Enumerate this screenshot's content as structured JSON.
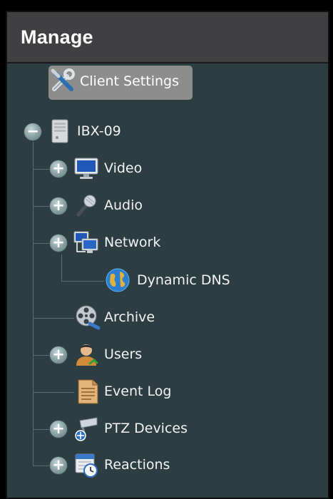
{
  "header": {
    "title": "Manage"
  },
  "tree": {
    "client_settings": {
      "label": "Client Settings",
      "icon": "tools-icon"
    },
    "root": {
      "label": "IBX-09",
      "icon": "server-icon",
      "expander": "−"
    },
    "items": [
      {
        "label": "Video",
        "icon": "monitor-icon",
        "expander": "+"
      },
      {
        "label": "Audio",
        "icon": "microphone-icon",
        "expander": "+"
      },
      {
        "label": "Network",
        "icon": "network-icon",
        "expander": "+"
      },
      {
        "label": "Dynamic DNS",
        "icon": "globe-icon"
      },
      {
        "label": "Archive",
        "icon": "film-reel-icon"
      },
      {
        "label": "Users",
        "icon": "user-icon",
        "expander": "+"
      },
      {
        "label": "Event Log",
        "icon": "document-icon"
      },
      {
        "label": "PTZ Devices",
        "icon": "camera-icon",
        "expander": "+"
      },
      {
        "label": "Reactions",
        "icon": "calendar-clock-icon",
        "expander": "+"
      }
    ]
  },
  "colors": {
    "panel_bg": "#2c3e41",
    "header_bg": "#404042",
    "selection_bg": "#8d8d8d",
    "tree_line": "#566f70",
    "text": "#f2f2f2"
  }
}
